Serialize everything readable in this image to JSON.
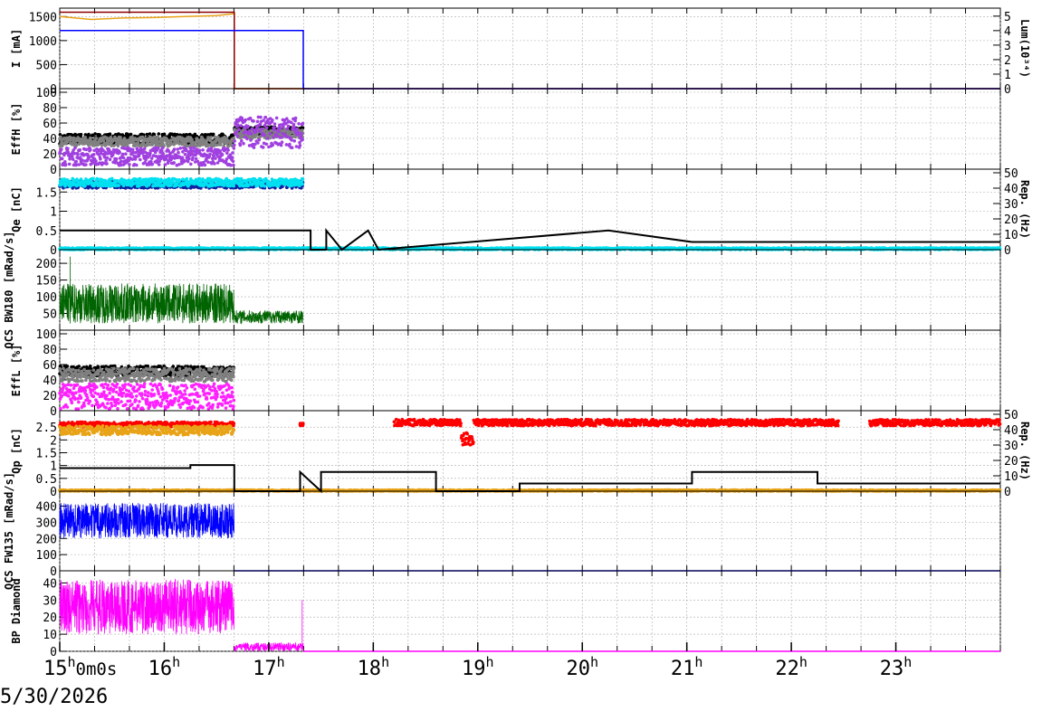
{
  "date_label": "5/30/2026",
  "x_axis": {
    "range_hours": [
      15.0,
      24.0
    ],
    "ticks": [
      {
        "h": 15,
        "label": "15h0m0s"
      },
      {
        "h": 16,
        "label": "16h"
      },
      {
        "h": 17,
        "label": "17h"
      },
      {
        "h": 18,
        "label": "18h"
      },
      {
        "h": 19,
        "label": "19h"
      },
      {
        "h": 20,
        "label": "20h"
      },
      {
        "h": 21,
        "label": "21h"
      },
      {
        "h": 22,
        "label": "22h"
      },
      {
        "h": 23,
        "label": "23h"
      }
    ]
  },
  "colors": {
    "her_current": "#e8a317",
    "ler_current": "#8b0000",
    "her_red": "#e03000",
    "lum": "#0000ff",
    "eff_black": "#000000",
    "eff_gray": "#808080",
    "eff_purple": "#a040e0",
    "eff_magenta": "#ff20ff",
    "qe_blue": "#1020a0",
    "qe_cyan": "#00e0f0",
    "rep_black": "#000000",
    "qcs_green": "#006400",
    "qp_red": "#ff0000",
    "qp_orange": "#e8a317",
    "qcs_blue": "#0000ff",
    "bp_magenta": "#ff00ff",
    "grid": "#aaaaaa"
  },
  "chart_data": [
    {
      "type": "line",
      "ylabel": "I [mA]",
      "ylim": [
        0,
        1600
      ],
      "yticks": [
        0,
        500,
        1000,
        1500
      ],
      "right_axis": {
        "label": "Lum(10³⁴)",
        "ylim": [
          0,
          5.3
        ],
        "ticks": [
          0,
          1,
          2,
          3,
          4,
          5
        ]
      },
      "series": [
        {
          "color": "her_current",
          "x": [
            15.0,
            15.3,
            15.6,
            15.9,
            16.2,
            16.5,
            16.67,
            16.67,
            24.0
          ],
          "y": [
            1500,
            1440,
            1470,
            1480,
            1500,
            1520,
            1560,
            0,
            0
          ]
        },
        {
          "color": "ler_current",
          "x": [
            15.0,
            16.67,
            16.67,
            24.0
          ],
          "y": [
            1590,
            1590,
            0,
            0
          ]
        },
        {
          "color": "lum",
          "axis": "right",
          "x": [
            15.0,
            17.33,
            17.33,
            24.0
          ],
          "y": [
            4.0,
            4.0,
            0,
            0
          ]
        }
      ]
    },
    {
      "type": "scatter",
      "ylabel": "EffH [%]",
      "ylim": [
        0,
        100
      ],
      "yticks": [
        0,
        20,
        40,
        60,
        80,
        100
      ],
      "series": [
        {
          "color": "eff_black",
          "x_range": [
            15.0,
            16.67
          ],
          "y_range": [
            33,
            46
          ]
        },
        {
          "color": "eff_gray",
          "x_range": [
            15.0,
            16.67
          ],
          "y_range": [
            30,
            42
          ]
        },
        {
          "color": "eff_purple",
          "x_range": [
            15.0,
            16.67
          ],
          "y_range": [
            5,
            28
          ]
        },
        {
          "color": "eff_black",
          "x_range": [
            16.67,
            17.33
          ],
          "y_range": [
            45,
            55
          ]
        },
        {
          "color": "eff_gray",
          "x_range": [
            16.67,
            17.33
          ],
          "y_range": [
            40,
            52
          ]
        },
        {
          "color": "eff_purple",
          "x_range": [
            16.67,
            17.33
          ],
          "y_range": [
            28,
            68
          ]
        }
      ]
    },
    {
      "type": "scatter",
      "ylabel": "Qe [nC]",
      "ylim": [
        0,
        2
      ],
      "yticks": [
        0,
        0.5,
        1,
        1.5
      ],
      "right_axis": {
        "label": "Rep. (Hz)",
        "ylim": [
          0,
          50
        ],
        "ticks": [
          0,
          10,
          20,
          30,
          40,
          50
        ]
      },
      "series": [
        {
          "color": "qe_blue",
          "x_range": [
            15.0,
            17.33
          ],
          "y_range": [
            1.6,
            1.78
          ]
        },
        {
          "color": "qe_cyan",
          "x_range": [
            15.0,
            17.33
          ],
          "y_range": [
            1.65,
            1.85
          ]
        },
        {
          "color": "qe_cyan",
          "x_range": [
            15.0,
            24.0
          ],
          "y_range": [
            0.0,
            0.05
          ]
        },
        {
          "color": "rep_black",
          "axis": "right",
          "step": true,
          "x": [
            15.0,
            17.4,
            17.4,
            17.55,
            17.55,
            17.7,
            17.7,
            17.95,
            17.95,
            18.05,
            18.05,
            20.25,
            20.25,
            21.05,
            21.05,
            24.0
          ],
          "y": [
            12.5,
            12.5,
            0,
            0,
            12.5,
            0,
            0,
            12.5,
            12.5,
            0,
            0,
            12.5,
            12.5,
            5,
            5,
            5
          ]
        }
      ]
    },
    {
      "type": "line",
      "ylabel": "QCS BW180 [mRad/s]",
      "ylim": [
        0,
        230
      ],
      "yticks": [
        50,
        100,
        150,
        200
      ],
      "series": [
        {
          "color": "qcs_green",
          "x_range": [
            15.0,
            16.67
          ],
          "y_range": [
            20,
            140
          ],
          "spike": {
            "x": 15.1,
            "y": 220
          }
        },
        {
          "color": "qcs_green",
          "x_range": [
            16.67,
            17.33
          ],
          "y_range": [
            20,
            60
          ]
        }
      ]
    },
    {
      "type": "scatter",
      "ylabel": "EffL [%]",
      "ylim": [
        0,
        100
      ],
      "yticks": [
        0,
        20,
        40,
        60,
        80,
        100
      ],
      "series": [
        {
          "color": "eff_black",
          "x_range": [
            15.0,
            16.67
          ],
          "y_range": [
            45,
            58
          ]
        },
        {
          "color": "eff_gray",
          "x_range": [
            15.0,
            16.67
          ],
          "y_range": [
            38,
            55
          ]
        },
        {
          "color": "eff_magenta",
          "x_range": [
            15.0,
            16.67
          ],
          "y_range": [
            2,
            35
          ]
        }
      ]
    },
    {
      "type": "scatter",
      "ylabel": "Qp [nC]",
      "ylim": [
        0,
        3
      ],
      "yticks": [
        0,
        0.5,
        1,
        1.5,
        2,
        2.5
      ],
      "right_axis": {
        "label": "Rep. (Hz)",
        "ylim": [
          0,
          50
        ],
        "ticks": [
          0,
          10,
          20,
          30,
          40,
          50
        ]
      },
      "series": [
        {
          "color": "qp_red",
          "x_range": [
            15.0,
            16.67
          ],
          "y_range": [
            2.5,
            2.7
          ]
        },
        {
          "color": "qp_orange",
          "x_range": [
            15.0,
            16.67
          ],
          "y_range": [
            2.2,
            2.55
          ]
        },
        {
          "color": "qp_red",
          "x_range": [
            17.3,
            17.33
          ],
          "y_range": [
            2.55,
            2.65
          ]
        },
        {
          "color": "qp_red",
          "x_range": [
            18.2,
            24.0
          ],
          "y_range": [
            2.55,
            2.8
          ],
          "gap": [
            22.45,
            22.75
          ],
          "dip": {
            "x": 18.9,
            "y": 1.8
          }
        },
        {
          "color": "qp_orange",
          "x_range": [
            15.0,
            24.0
          ],
          "y_range": [
            0.0,
            0.05
          ]
        },
        {
          "color": "rep_black",
          "axis": "right",
          "step": true,
          "x": [
            15.0,
            16.25,
            16.25,
            16.67,
            16.67,
            17.3,
            17.3,
            17.5,
            17.5,
            18.6,
            18.6,
            19.4,
            19.4,
            21.05,
            21.05,
            22.25,
            22.25,
            24.0
          ],
          "y": [
            15,
            15,
            17,
            17,
            0,
            0,
            12.5,
            0,
            12.5,
            12.5,
            0,
            0,
            5,
            5,
            12.5,
            12.5,
            5,
            5
          ]
        }
      ]
    },
    {
      "type": "line",
      "ylabel": "QCS FW135 [mRad/s]",
      "ylim": [
        0,
        470
      ],
      "yticks": [
        0,
        100,
        200,
        300,
        400
      ],
      "series": [
        {
          "color": "qcs_blue",
          "x_range": [
            15.0,
            16.67
          ],
          "y_range": [
            200,
            420
          ]
        },
        {
          "color": "qcs_blue",
          "x": [
            16.67,
            24.0
          ],
          "y": [
            0,
            0
          ]
        }
      ]
    },
    {
      "type": "line",
      "ylabel": "BP Diamond",
      "ylim": [
        0,
        45
      ],
      "yticks": [
        0,
        10,
        20,
        30,
        40
      ],
      "series": [
        {
          "color": "bp_magenta",
          "x_range": [
            15.0,
            16.67
          ],
          "y_range": [
            10,
            42
          ]
        },
        {
          "color": "bp_magenta",
          "x_range": [
            16.67,
            17.33
          ],
          "y_range": [
            0,
            5
          ],
          "spike": {
            "x": 17.32,
            "y": 30
          }
        },
        {
          "color": "bp_magenta",
          "x": [
            17.33,
            24.0
          ],
          "y": [
            0,
            0
          ]
        }
      ]
    }
  ]
}
